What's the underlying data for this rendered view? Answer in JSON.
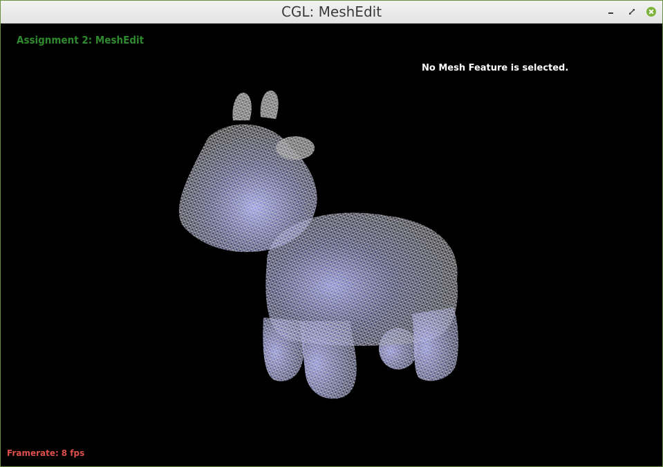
{
  "window": {
    "title": "CGL: MeshEdit"
  },
  "viewport": {
    "assignment_title": "Assignment 2: MeshEdit",
    "selection_status": "No Mesh Feature is selected.",
    "framerate_label": "Framerate:",
    "framerate_value": "8 fps"
  },
  "colors": {
    "assignment_title": "#2f8a2f",
    "framerate": "#e0504a",
    "mesh_wire": "#c8c8c8",
    "mesh_shade": "#8a8ce0"
  },
  "icons": {
    "minimize": "minimize-icon",
    "maximize": "maximize-icon",
    "close": "close-icon"
  }
}
